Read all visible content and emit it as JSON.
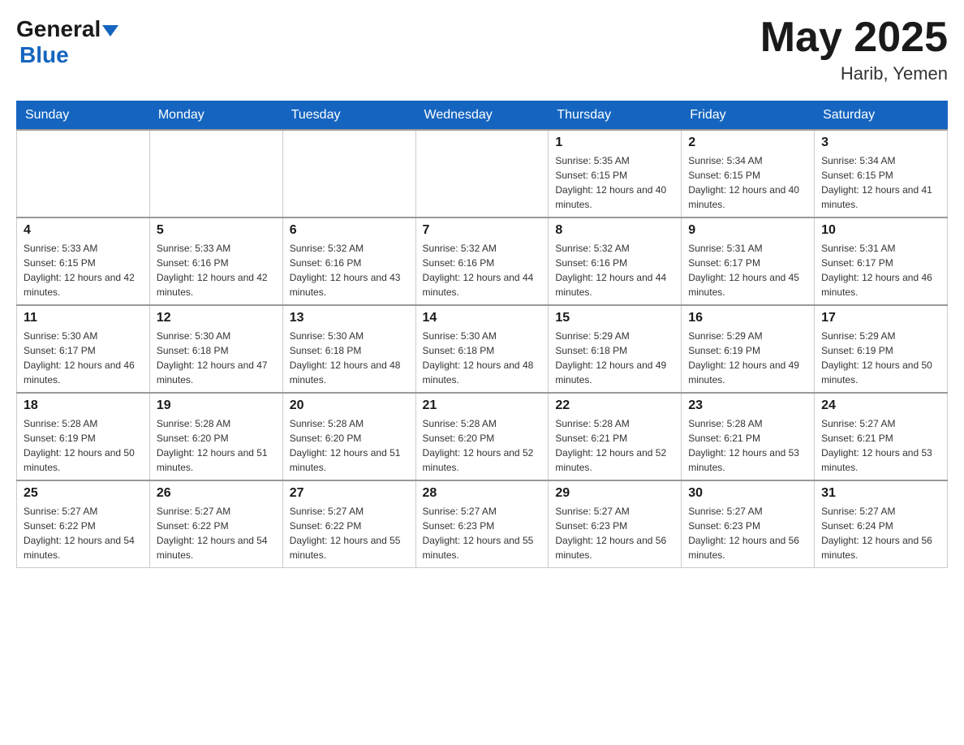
{
  "header": {
    "logo_general": "General",
    "logo_blue": "Blue",
    "month_title": "May 2025",
    "location": "Harib, Yemen"
  },
  "days_of_week": [
    "Sunday",
    "Monday",
    "Tuesday",
    "Wednesday",
    "Thursday",
    "Friday",
    "Saturday"
  ],
  "weeks": [
    [
      {
        "day": "",
        "info": ""
      },
      {
        "day": "",
        "info": ""
      },
      {
        "day": "",
        "info": ""
      },
      {
        "day": "",
        "info": ""
      },
      {
        "day": "1",
        "info": "Sunrise: 5:35 AM\nSunset: 6:15 PM\nDaylight: 12 hours and 40 minutes."
      },
      {
        "day": "2",
        "info": "Sunrise: 5:34 AM\nSunset: 6:15 PM\nDaylight: 12 hours and 40 minutes."
      },
      {
        "day": "3",
        "info": "Sunrise: 5:34 AM\nSunset: 6:15 PM\nDaylight: 12 hours and 41 minutes."
      }
    ],
    [
      {
        "day": "4",
        "info": "Sunrise: 5:33 AM\nSunset: 6:15 PM\nDaylight: 12 hours and 42 minutes."
      },
      {
        "day": "5",
        "info": "Sunrise: 5:33 AM\nSunset: 6:16 PM\nDaylight: 12 hours and 42 minutes."
      },
      {
        "day": "6",
        "info": "Sunrise: 5:32 AM\nSunset: 6:16 PM\nDaylight: 12 hours and 43 minutes."
      },
      {
        "day": "7",
        "info": "Sunrise: 5:32 AM\nSunset: 6:16 PM\nDaylight: 12 hours and 44 minutes."
      },
      {
        "day": "8",
        "info": "Sunrise: 5:32 AM\nSunset: 6:16 PM\nDaylight: 12 hours and 44 minutes."
      },
      {
        "day": "9",
        "info": "Sunrise: 5:31 AM\nSunset: 6:17 PM\nDaylight: 12 hours and 45 minutes."
      },
      {
        "day": "10",
        "info": "Sunrise: 5:31 AM\nSunset: 6:17 PM\nDaylight: 12 hours and 46 minutes."
      }
    ],
    [
      {
        "day": "11",
        "info": "Sunrise: 5:30 AM\nSunset: 6:17 PM\nDaylight: 12 hours and 46 minutes."
      },
      {
        "day": "12",
        "info": "Sunrise: 5:30 AM\nSunset: 6:18 PM\nDaylight: 12 hours and 47 minutes."
      },
      {
        "day": "13",
        "info": "Sunrise: 5:30 AM\nSunset: 6:18 PM\nDaylight: 12 hours and 48 minutes."
      },
      {
        "day": "14",
        "info": "Sunrise: 5:30 AM\nSunset: 6:18 PM\nDaylight: 12 hours and 48 minutes."
      },
      {
        "day": "15",
        "info": "Sunrise: 5:29 AM\nSunset: 6:18 PM\nDaylight: 12 hours and 49 minutes."
      },
      {
        "day": "16",
        "info": "Sunrise: 5:29 AM\nSunset: 6:19 PM\nDaylight: 12 hours and 49 minutes."
      },
      {
        "day": "17",
        "info": "Sunrise: 5:29 AM\nSunset: 6:19 PM\nDaylight: 12 hours and 50 minutes."
      }
    ],
    [
      {
        "day": "18",
        "info": "Sunrise: 5:28 AM\nSunset: 6:19 PM\nDaylight: 12 hours and 50 minutes."
      },
      {
        "day": "19",
        "info": "Sunrise: 5:28 AM\nSunset: 6:20 PM\nDaylight: 12 hours and 51 minutes."
      },
      {
        "day": "20",
        "info": "Sunrise: 5:28 AM\nSunset: 6:20 PM\nDaylight: 12 hours and 51 minutes."
      },
      {
        "day": "21",
        "info": "Sunrise: 5:28 AM\nSunset: 6:20 PM\nDaylight: 12 hours and 52 minutes."
      },
      {
        "day": "22",
        "info": "Sunrise: 5:28 AM\nSunset: 6:21 PM\nDaylight: 12 hours and 52 minutes."
      },
      {
        "day": "23",
        "info": "Sunrise: 5:28 AM\nSunset: 6:21 PM\nDaylight: 12 hours and 53 minutes."
      },
      {
        "day": "24",
        "info": "Sunrise: 5:27 AM\nSunset: 6:21 PM\nDaylight: 12 hours and 53 minutes."
      }
    ],
    [
      {
        "day": "25",
        "info": "Sunrise: 5:27 AM\nSunset: 6:22 PM\nDaylight: 12 hours and 54 minutes."
      },
      {
        "day": "26",
        "info": "Sunrise: 5:27 AM\nSunset: 6:22 PM\nDaylight: 12 hours and 54 minutes."
      },
      {
        "day": "27",
        "info": "Sunrise: 5:27 AM\nSunset: 6:22 PM\nDaylight: 12 hours and 55 minutes."
      },
      {
        "day": "28",
        "info": "Sunrise: 5:27 AM\nSunset: 6:23 PM\nDaylight: 12 hours and 55 minutes."
      },
      {
        "day": "29",
        "info": "Sunrise: 5:27 AM\nSunset: 6:23 PM\nDaylight: 12 hours and 56 minutes."
      },
      {
        "day": "30",
        "info": "Sunrise: 5:27 AM\nSunset: 6:23 PM\nDaylight: 12 hours and 56 minutes."
      },
      {
        "day": "31",
        "info": "Sunrise: 5:27 AM\nSunset: 6:24 PM\nDaylight: 12 hours and 56 minutes."
      }
    ]
  ]
}
